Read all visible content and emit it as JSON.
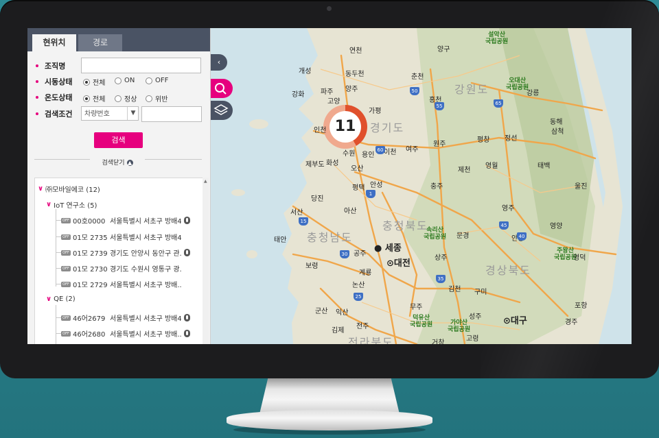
{
  "tabs": {
    "current_location": "현위치",
    "route": "경로"
  },
  "filters": {
    "org_label": "조직명",
    "org_value": "",
    "driving_label": "시동상태",
    "driving_options": [
      "전체",
      "ON",
      "OFF"
    ],
    "driving_selected": "전체",
    "temp_label": "온도상태",
    "temp_options": [
      "전체",
      "정상",
      "위반"
    ],
    "temp_selected": "전체",
    "search_condition_label": "검색조건",
    "search_condition_select": "차량번호",
    "search_condition_value": "",
    "search_button": "검색",
    "close_search": "검색닫기"
  },
  "tree": {
    "root": {
      "label": "㈜모바일에코 (12)"
    },
    "groups": [
      {
        "label": "IoT 연구소 (5)",
        "vehicles": [
          {
            "status": "OFF",
            "plate": "00호0000",
            "address": "서울특별시 서초구 방배4동",
            "thermo": true
          },
          {
            "status": "OFF",
            "plate": "01모 2735",
            "address": "서울특별시 서초구 방배4동",
            "thermo": false
          },
          {
            "status": "OFF",
            "plate": "01모 2739",
            "address": "경기도 안양시 동안구 관...",
            "thermo": true
          },
          {
            "status": "OFF",
            "plate": "01모 2730",
            "address": "경기도 수원시 영통구 광...",
            "thermo": false
          },
          {
            "status": "OFF",
            "plate": "01모 2729",
            "address": "서울특별시 서초구 방배...",
            "thermo": false
          }
        ]
      },
      {
        "label": "QE (2)",
        "vehicles": [
          {
            "status": "OFF",
            "plate": "46어2679",
            "address": "서울특별시 서초구 방배4동",
            "thermo": true
          },
          {
            "status": "OFF",
            "plate": "46어2680",
            "address": "서울특별시 서초구 방배...",
            "thermo": true
          }
        ]
      }
    ]
  },
  "map": {
    "cluster_count": "11",
    "controls": [
      "collapse-icon",
      "search-icon",
      "layers-icon"
    ],
    "cities": [
      "연천",
      "양구",
      "개성",
      "동두천",
      "춘천",
      "강화",
      "파주",
      "양주",
      "홍천",
      "고양",
      "강릉",
      "가평",
      "인천",
      "수원",
      "용인",
      "이천",
      "여주",
      "원주",
      "평창",
      "정선",
      "삼척",
      "동해",
      "화성",
      "오산",
      "제천",
      "영월",
      "태백",
      "평택",
      "안성",
      "충주",
      "울진",
      "당진",
      "아산",
      "영주",
      "서산",
      "공주",
      "문경",
      "영양",
      "보령",
      "상주",
      "안동",
      "계룡",
      "구미",
      "영덕",
      "논산",
      "김천",
      "포항",
      "군산",
      "익산",
      "무주",
      "성주",
      "경주",
      "김제",
      "전주",
      "고령",
      "거창",
      "제부도",
      "태안"
    ],
    "big_cities": [
      "세종",
      "대전",
      "대구"
    ],
    "provinces": [
      "강원도",
      "경기도",
      "충청북도",
      "충청남도",
      "경상북도",
      "전라북도"
    ],
    "parks": [
      "설악산\n국립공원",
      "오대산\n국립공원",
      "속리산\n국립공원",
      "주왕산\n국립공원",
      "덕유산\n국립공원",
      "가야산\n국립공원"
    ],
    "highways": [
      "50",
      "55",
      "65",
      "60",
      "1",
      "15",
      "45",
      "35",
      "25",
      "30",
      "40"
    ]
  },
  "colors": {
    "accent": "#e6007e",
    "panel_dark": "#4a5364",
    "road": "#f0a64a"
  }
}
